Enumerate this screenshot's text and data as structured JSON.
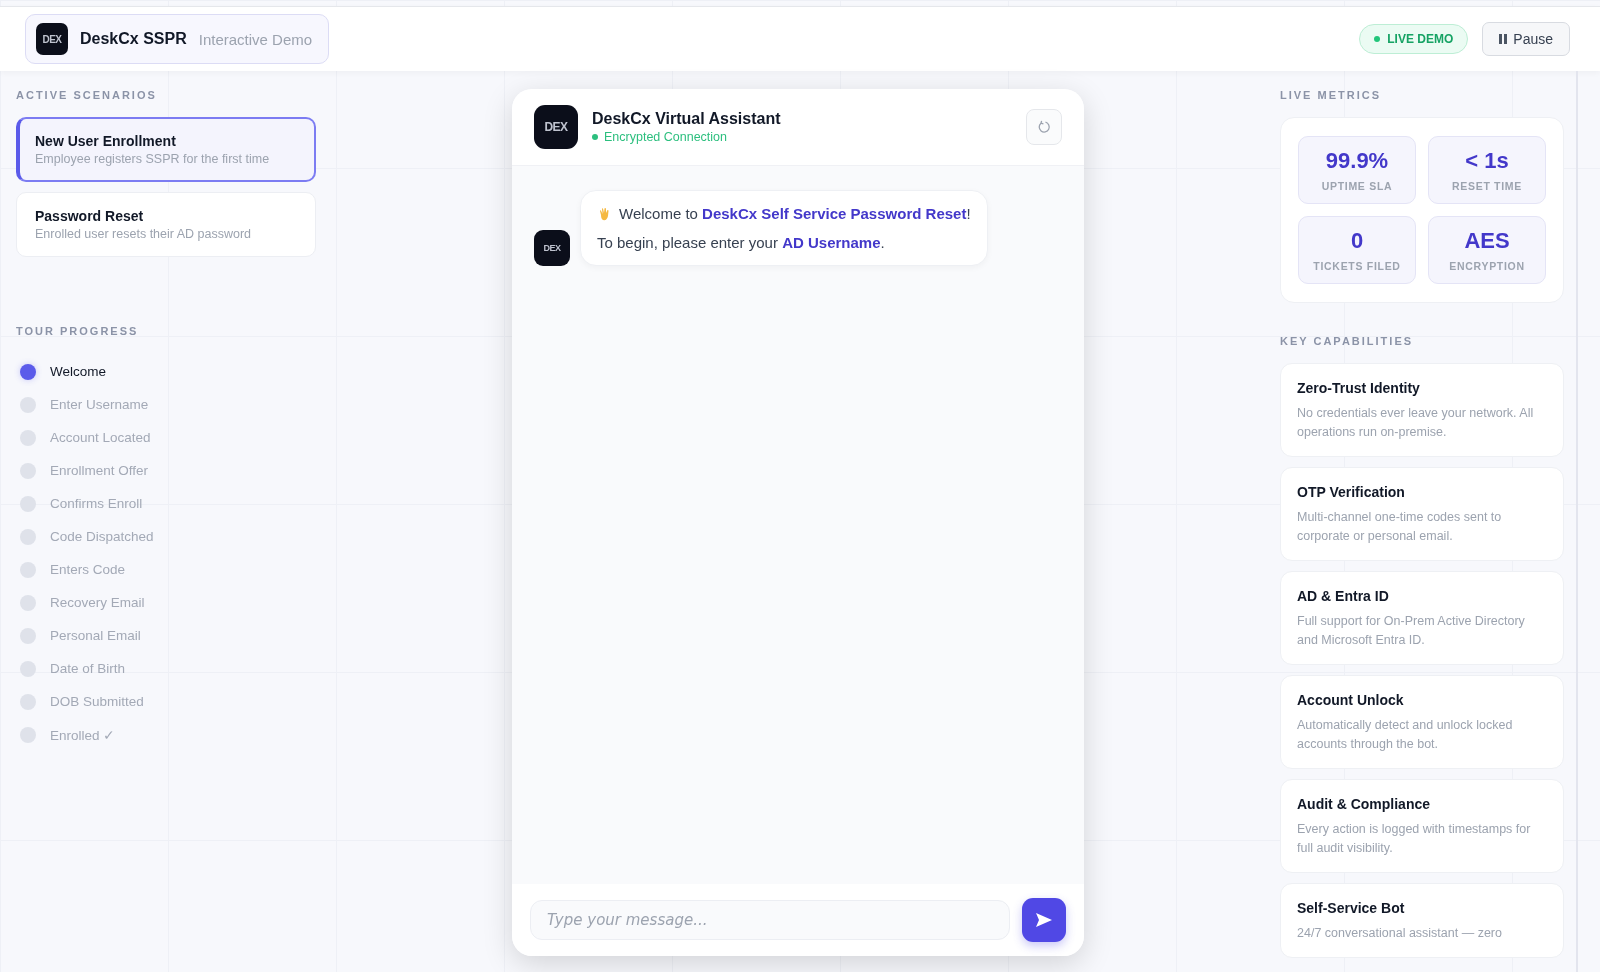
{
  "header": {
    "logo_text": "DEX",
    "title": "DeskCx SSPR",
    "subtitle": "Interactive Demo",
    "live_badge": "LIVE DEMO",
    "pause_button": "Pause"
  },
  "scenarios": {
    "heading": "ACTIVE SCENARIOS",
    "items": [
      {
        "title": "New User Enrollment",
        "description": "Employee registers SSPR for the first time",
        "selected": true
      },
      {
        "title": "Password Reset",
        "description": "Enrolled user resets their AD password",
        "selected": false
      }
    ]
  },
  "tour": {
    "heading": "TOUR PROGRESS",
    "steps": [
      {
        "label": "Welcome",
        "active": true
      },
      {
        "label": "Enter Username",
        "active": false
      },
      {
        "label": "Account Located",
        "active": false
      },
      {
        "label": "Enrollment Offer",
        "active": false
      },
      {
        "label": "Confirms Enroll",
        "active": false
      },
      {
        "label": "Code Dispatched",
        "active": false
      },
      {
        "label": "Enters Code",
        "active": false
      },
      {
        "label": "Recovery Email",
        "active": false
      },
      {
        "label": "Personal Email",
        "active": false
      },
      {
        "label": "Date of Birth",
        "active": false
      },
      {
        "label": "DOB Submitted",
        "active": false
      },
      {
        "label": "Enrolled ✓",
        "active": false
      }
    ]
  },
  "chat": {
    "logo_text": "DEX",
    "title": "DeskCx Virtual Assistant",
    "status": "Encrypted Connection",
    "messages": [
      {
        "avatar_text": "DEX",
        "lines": [
          "Welcome to **DeskCx Self Service Password Reset**!",
          "To begin, please enter your **AD Username**."
        ]
      }
    ],
    "input": {
      "placeholder": "Type your message..."
    }
  },
  "metrics": {
    "heading": "LIVE METRICS",
    "items": [
      {
        "value": "99.9%",
        "label": "UPTIME SLA"
      },
      {
        "value": "< 1s",
        "label": "RESET TIME"
      },
      {
        "value": "0",
        "label": "TICKETS FILED"
      },
      {
        "value": "AES",
        "label": "ENCRYPTION"
      }
    ]
  },
  "capabilities": {
    "heading": "KEY CAPABILITIES",
    "items": [
      {
        "title": "Zero-Trust Identity",
        "description": "No credentials ever leave your network. All operations run on-premise."
      },
      {
        "title": "OTP Verification",
        "description": "Multi-channel one-time codes sent to corporate or personal email."
      },
      {
        "title": "AD & Entra ID",
        "description": "Full support for On-Prem Active Directory and Microsoft Entra ID."
      },
      {
        "title": "Account Unlock",
        "description": "Automatically detect and unlock locked accounts through the bot."
      },
      {
        "title": "Audit & Compliance",
        "description": "Every action is logged with timestamps for full audit visibility."
      },
      {
        "title": "Self-Service Bot",
        "description": "24/7 conversational assistant — zero"
      }
    ]
  }
}
